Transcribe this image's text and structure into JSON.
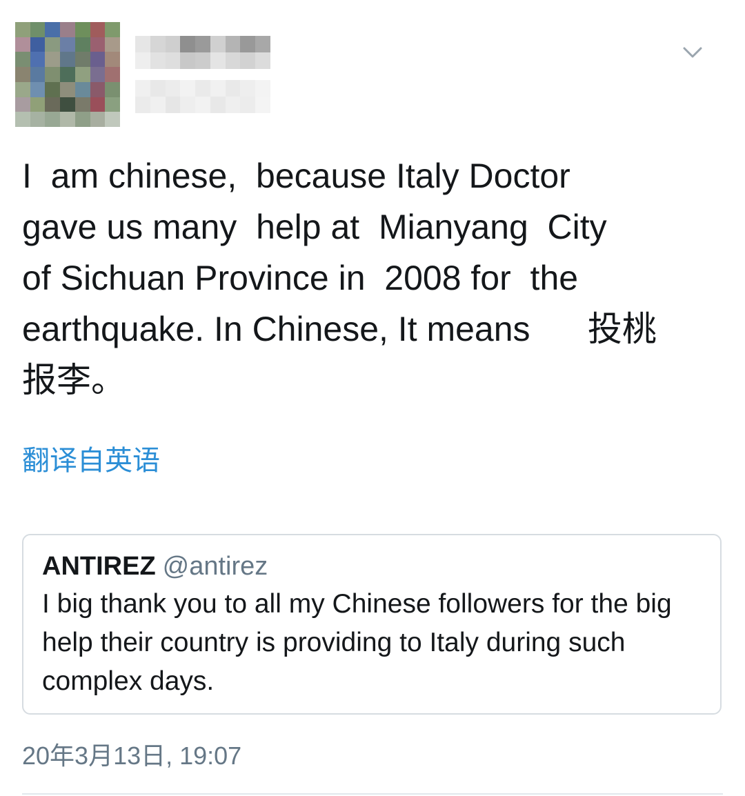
{
  "tweet": {
    "text": "I  am chinese,  because Italy Doctor\ngave us many  help at  Mianyang  City\nof Sichuan Province in  2008 for  the\nearthquake. In Chinese, It means      投桃\n报李。",
    "translate_label": "翻译自英语",
    "timestamp": "20年3月13日, 19:07",
    "menu_icon": "chevron-down-icon"
  },
  "quote": {
    "name": "ANTIREZ",
    "handle": "@antirez",
    "text": "I big thank you to all my Chinese followers for the big help their country is providing to Italy during such complex days."
  },
  "colors": {
    "link": "#2b8ed6",
    "secondary_text": "#657786",
    "border": "#d6dce1"
  }
}
